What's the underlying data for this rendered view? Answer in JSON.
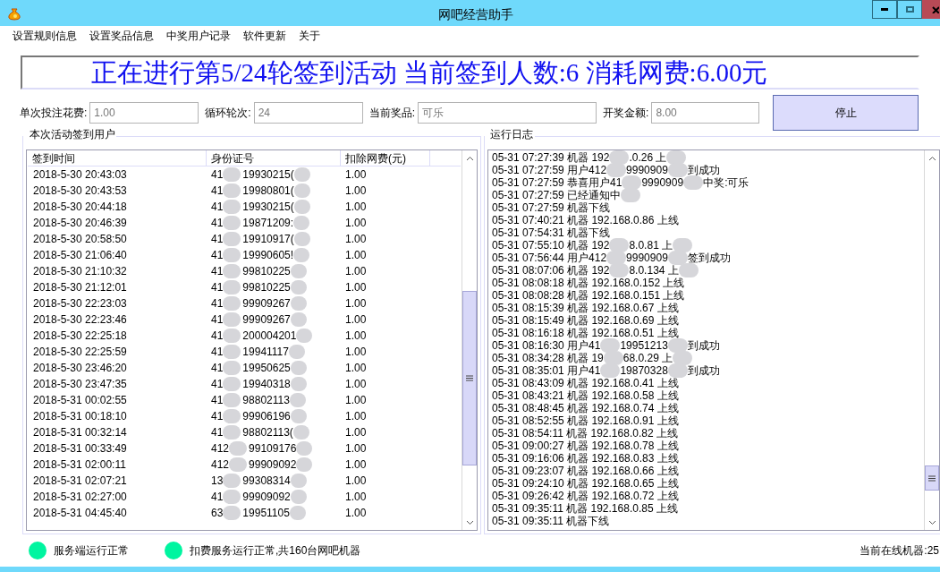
{
  "window": {
    "title": "网吧经营助手"
  },
  "menu": [
    "设置规则信息",
    "设置奖品信息",
    "中奖用户记录",
    "软件更新",
    "关于"
  ],
  "banner": "正在进行第5/24轮签到活动 当前签到人数:6 消耗网费:6.00元",
  "fields": [
    {
      "label": "单次投注花费:",
      "value": "1.00"
    },
    {
      "label": "循环轮次:",
      "value": "24"
    },
    {
      "label": "当前奖品:",
      "value": "可乐"
    },
    {
      "label": "开奖金额:",
      "value": "8.00"
    }
  ],
  "stop_button": "停止",
  "checkins": {
    "title": "本次活动签到用户",
    "columns": [
      "签到时间",
      "身份证号",
      "扣除网费(元)"
    ],
    "rows": [
      {
        "time": "2018-5-30 20:43:03",
        "id_head": "41",
        "id_tail": "19930215(",
        "fee": "1.00"
      },
      {
        "time": "2018-5-30 20:43:53",
        "id_head": "41",
        "id_tail": "19980801(",
        "fee": "1.00"
      },
      {
        "time": "2018-5-30 20:44:18",
        "id_head": "41",
        "id_tail": "19930215(",
        "fee": "1.00"
      },
      {
        "time": "2018-5-30 20:46:39",
        "id_head": "41",
        "id_tail": "19871209:",
        "fee": "1.00"
      },
      {
        "time": "2018-5-30 20:58:50",
        "id_head": "41",
        "id_tail": "19910917(",
        "fee": "1.00"
      },
      {
        "time": "2018-5-30 21:06:40",
        "id_head": "41",
        "id_tail": "19990605!",
        "fee": "1.00"
      },
      {
        "time": "2018-5-30 21:10:32",
        "id_head": "41",
        "id_tail": "99810225",
        "fee": "1.00"
      },
      {
        "time": "2018-5-30 21:12:01",
        "id_head": "41",
        "id_tail": "99810225",
        "fee": "1.00"
      },
      {
        "time": "2018-5-30 22:23:03",
        "id_head": "41",
        "id_tail": "99909267",
        "fee": "1.00"
      },
      {
        "time": "2018-5-30 22:23:46",
        "id_head": "41",
        "id_tail": "99909267",
        "fee": "1.00"
      },
      {
        "time": "2018-5-30 22:25:18",
        "id_head": "41",
        "id_tail": "200004201",
        "fee": "1.00"
      },
      {
        "time": "2018-5-30 22:25:59",
        "id_head": "41",
        "id_tail": "19941117",
        "fee": "1.00"
      },
      {
        "time": "2018-5-30 23:46:20",
        "id_head": "41",
        "id_tail": "19950625",
        "fee": "1.00"
      },
      {
        "time": "2018-5-30 23:47:35",
        "id_head": "41",
        "id_tail": "19940318",
        "fee": "1.00"
      },
      {
        "time": "2018-5-31 00:02:55",
        "id_head": "41",
        "id_tail": "98802113",
        "fee": "1.00"
      },
      {
        "time": "2018-5-31 00:18:10",
        "id_head": "41",
        "id_tail": "99906196",
        "fee": "1.00"
      },
      {
        "time": "2018-5-31 00:32:14",
        "id_head": "41",
        "id_tail": "98802113(",
        "fee": "1.00"
      },
      {
        "time": "2018-5-31 00:33:49",
        "id_head": "412",
        "id_tail": "99109176",
        "fee": "1.00"
      },
      {
        "time": "2018-5-31 02:00:11",
        "id_head": "412",
        "id_tail": "99909092",
        "fee": "1.00"
      },
      {
        "time": "2018-5-31 02:07:21",
        "id_head": "13",
        "id_tail": "99308314",
        "fee": "1.00"
      },
      {
        "time": "2018-5-31 02:27:00",
        "id_head": "41",
        "id_tail": "99909092",
        "fee": "1.00"
      },
      {
        "time": "2018-5-31 04:45:40",
        "id_head": "63",
        "id_tail": "19951105",
        "fee": "1.00"
      }
    ]
  },
  "log": {
    "title": "运行日志",
    "lines": [
      [
        {
          "kind": "text",
          "text": "05-31 07:27:39 机器 192"
        },
        {
          "kind": "redacted"
        },
        {
          "kind": "text",
          "text": ".0.26 上"
        },
        {
          "kind": "redacted"
        }
      ],
      [
        {
          "kind": "text",
          "text": "05-31 07:27:59 用户412"
        },
        {
          "kind": "redacted"
        },
        {
          "kind": "text",
          "text": "9990909"
        },
        {
          "kind": "redacted"
        },
        {
          "kind": "text",
          "text": "到成功"
        }
      ],
      [
        {
          "kind": "text",
          "text": "05-31 07:27:59 恭喜用户41"
        },
        {
          "kind": "redacted"
        },
        {
          "kind": "text",
          "text": "9990909"
        },
        {
          "kind": "redacted"
        },
        {
          "kind": "text",
          "text": "中奖:可乐"
        }
      ],
      [
        {
          "kind": "text",
          "text": "05-31 07:27:59 已经通知中"
        },
        {
          "kind": "redacted"
        }
      ],
      [
        {
          "kind": "text",
          "text": "05-31 07:27:59 机器下线"
        }
      ],
      [
        {
          "kind": "text",
          "text": "05-31 07:40:21 机器 192.168.0.86 上线"
        }
      ],
      [
        {
          "kind": "text",
          "text": "05-31 07:54:31 机器下线"
        }
      ],
      [
        {
          "kind": "text",
          "text": "05-31 07:55:10 机器 192"
        },
        {
          "kind": "redacted"
        },
        {
          "kind": "text",
          "text": "8.0.81 上"
        },
        {
          "kind": "redacted"
        }
      ],
      [
        {
          "kind": "text",
          "text": "05-31 07:56:44 用户412"
        },
        {
          "kind": "redacted"
        },
        {
          "kind": "text",
          "text": "9990909"
        },
        {
          "kind": "redacted"
        },
        {
          "kind": "text",
          "text": "签到成功"
        }
      ],
      [
        {
          "kind": "text",
          "text": "05-31 08:07:06 机器 192"
        },
        {
          "kind": "redacted"
        },
        {
          "kind": "text",
          "text": "8.0.134 上"
        },
        {
          "kind": "redacted"
        }
      ],
      [
        {
          "kind": "text",
          "text": "05-31 08:08:18 机器 192.168.0.152 上线"
        }
      ],
      [
        {
          "kind": "text",
          "text": "05-31 08:08:28 机器 192.168.0.151 上线"
        }
      ],
      [
        {
          "kind": "text",
          "text": "05-31 08:15:39 机器 192.168.0.67 上线"
        }
      ],
      [
        {
          "kind": "text",
          "text": "05-31 08:15:49 机器 192.168.0.69 上线"
        }
      ],
      [
        {
          "kind": "text",
          "text": "05-31 08:16:18 机器 192.168.0.51 上线"
        }
      ],
      [
        {
          "kind": "text",
          "text": "05-31 08:16:30 用户41"
        },
        {
          "kind": "redacted"
        },
        {
          "kind": "text",
          "text": "19951213"
        },
        {
          "kind": "redacted"
        },
        {
          "kind": "text",
          "text": "到成功"
        }
      ],
      [
        {
          "kind": "text",
          "text": "05-31 08:34:28 机器 19"
        },
        {
          "kind": "redacted"
        },
        {
          "kind": "text",
          "text": "68.0.29 上"
        },
        {
          "kind": "redacted"
        }
      ],
      [
        {
          "kind": "text",
          "text": "05-31 08:35:01 用户41"
        },
        {
          "kind": "redacted"
        },
        {
          "kind": "text",
          "text": "19870328"
        },
        {
          "kind": "redacted"
        },
        {
          "kind": "text",
          "text": "到成功"
        }
      ],
      [
        {
          "kind": "text",
          "text": "05-31 08:43:09 机器 192.168.0.41 上线"
        }
      ],
      [
        {
          "kind": "text",
          "text": "05-31 08:43:21 机器 192.168.0.58 上线"
        }
      ],
      [
        {
          "kind": "text",
          "text": "05-31 08:48:45 机器 192.168.0.74 上线"
        }
      ],
      [
        {
          "kind": "text",
          "text": "05-31 08:52:55 机器 192.168.0.91 上线"
        }
      ],
      [
        {
          "kind": "text",
          "text": "05-31 08:54:11 机器 192.168.0.82 上线"
        }
      ],
      [
        {
          "kind": "text",
          "text": "05-31 09:00:27 机器 192.168.0.78 上线"
        }
      ],
      [
        {
          "kind": "text",
          "text": "05-31 09:16:06 机器 192.168.0.83 上线"
        }
      ],
      [
        {
          "kind": "text",
          "text": "05-31 09:23:07 机器 192.168.0.66 上线"
        }
      ],
      [
        {
          "kind": "text",
          "text": "05-31 09:24:10 机器 192.168.0.65 上线"
        }
      ],
      [
        {
          "kind": "text",
          "text": "05-31 09:26:42 机器 192.168.0.72 上线"
        }
      ],
      [
        {
          "kind": "text",
          "text": "05-31 09:35:11 机器 192.168.0.85 上线"
        }
      ],
      [
        {
          "kind": "text",
          "text": "05-31 09:35:11 机器下线"
        }
      ]
    ]
  },
  "status": [
    {
      "text": "服务端运行正常",
      "color": "#00f5a0"
    },
    {
      "text": "扣费服务运行正常,共160台网吧机器",
      "color": "#00f5a0"
    }
  ],
  "online": "当前在线机器:25"
}
